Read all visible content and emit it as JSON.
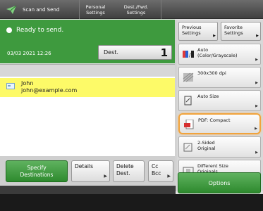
{
  "tabs": {
    "scan_and_send": "Scan and Send",
    "personal_settings": "Personal\nSettings",
    "dest_fwd_settings": "Dest./Fwd.\nSettings"
  },
  "status": {
    "text": "Ready to send."
  },
  "info": {
    "datetime": "03/03 2021 12:26",
    "dest_label": "Dest.",
    "dest_count": "1"
  },
  "contact": {
    "name": "John",
    "email": "john@example.com"
  },
  "buttons": {
    "specify": "Specify\nDestinations",
    "details": "Details",
    "delete": "Delete\nDest.",
    "cc": "Cc\nBcc",
    "options": "Options"
  },
  "right": {
    "previous": "Previous\nSettings",
    "favorite": "Favorite\nSettings"
  },
  "options": [
    {
      "icon": "color-mode-icon",
      "label": "Auto\n(Color/Grayscale)"
    },
    {
      "icon": "resolution-icon",
      "label": "300x300 dpi"
    },
    {
      "icon": "auto-size-icon",
      "label": "Auto Size"
    },
    {
      "icon": "pdf-icon",
      "label": "PDF: Compact"
    },
    {
      "icon": "two-sided-icon",
      "label": "2-Sided\nOriginal"
    },
    {
      "icon": "different-size-icon",
      "label": "Different Size\nOriginals"
    }
  ],
  "colors": {
    "green": "#3e9a3e",
    "highlight": "#f1a33b",
    "selected_row": "#fdfa68"
  }
}
